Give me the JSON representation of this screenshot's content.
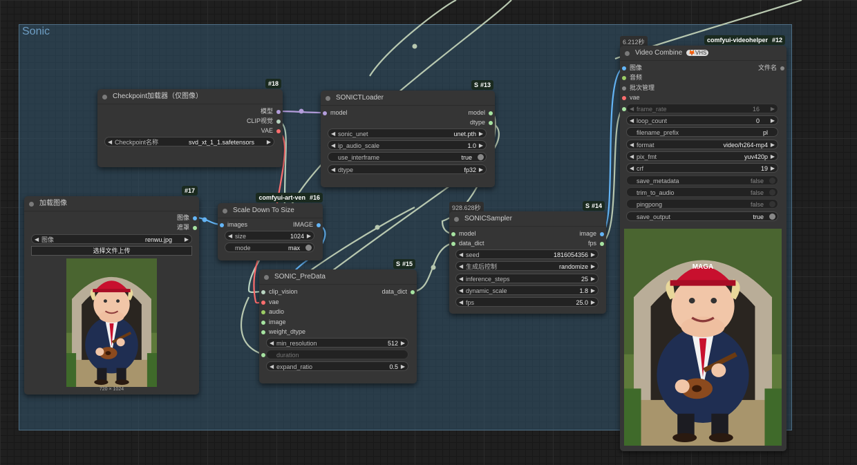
{
  "group": {
    "title": "Sonic"
  },
  "colors": {
    "model": "#b39ddb",
    "clip": "#f4d35e",
    "vae": "#ff6e6e",
    "image": "#64b5f6",
    "audio": "#9ccc65",
    "any": "#a6e3a1"
  },
  "n18": {
    "badge": "#18",
    "title": "Checkpoint加载器（仅图像）",
    "out_model": "模型",
    "out_clip": "CLIP视觉",
    "out_vae": "VAE",
    "ckpt_label": "Checkpoint名称",
    "ckpt_value": "svd_xt_1_1.safetensors"
  },
  "n13": {
    "badge": "#13",
    "badge_prefix": "S",
    "title": "SONICTLoader",
    "in_model": "model",
    "out_model": "model",
    "out_dtype": "dtype",
    "sonic_unet_label": "sonic_unet",
    "sonic_unet_value": "unet.pth",
    "ip_audio_scale_label": "ip_audio_scale",
    "ip_audio_scale_value": "1.0",
    "use_interframe_label": "use_interframe",
    "use_interframe_value": "true",
    "dtype_label": "dtype",
    "dtype_value": "fp32"
  },
  "n17": {
    "badge": "#17",
    "title": "加载图像",
    "out_image": "图像",
    "out_mask": "遮罩",
    "image_label": "图像",
    "image_value": "renwu.jpg",
    "upload_label": "选择文件上传",
    "caption": "720 × 1024"
  },
  "n16": {
    "badge": "#16",
    "badge_text": "comfyui-art-ven",
    "title": "Scale Down To Size",
    "in_images": "images",
    "out_image": "IMAGE",
    "size_label": "size",
    "size_value": "1024",
    "mode_label": "mode",
    "mode_value": "max"
  },
  "n15": {
    "badge": "#15",
    "badge_prefix": "S",
    "title": "SONIC_PreData",
    "in_clip_vision": "clip_vision",
    "in_vae": "vae",
    "in_audio": "audio",
    "in_image": "image",
    "in_weight_dtype": "weight_dtype",
    "out_data_dict": "data_dict",
    "min_resolution_label": "min_resolution",
    "min_resolution_value": "512",
    "duration_label": "duration",
    "expand_ratio_label": "expand_ratio",
    "expand_ratio_value": "0.5"
  },
  "n14": {
    "badge": "#14",
    "badge_prefix": "S",
    "timer": "928.628秒",
    "title": "SONICSampler",
    "in_model": "model",
    "in_data_dict": "data_dict",
    "out_image": "image",
    "out_fps": "fps",
    "seed_label": "seed",
    "seed_value": "1816054356",
    "control_label": "生成后控制",
    "control_value": "randomize",
    "steps_label": "inference_steps",
    "steps_value": "25",
    "dynamic_scale_label": "dynamic_scale",
    "dynamic_scale_value": "1.8",
    "fps_label": "fps",
    "fps_value": "25.0"
  },
  "n12": {
    "badge": "#12",
    "badge_text": "comfyui-videohelper",
    "timer": "6.212秒",
    "title": "Video Combine",
    "title_icons": "🦊VHS",
    "in_images": "图像",
    "in_audio": "音频",
    "in_batch": "批次管理",
    "in_vae": "vae",
    "out_filenames": "文件名",
    "frame_rate_label": "frame_rate",
    "frame_rate_value": "16",
    "loop_count_label": "loop_count",
    "loop_count_value": "0",
    "filename_prefix_label": "filename_prefix",
    "filename_prefix_value": "pl",
    "format_label": "format",
    "format_value": "video/h264-mp4",
    "pix_fmt_label": "pix_fmt",
    "pix_fmt_value": "yuv420p",
    "crf_label": "crf",
    "crf_value": "19",
    "save_metadata_label": "save_metadata",
    "save_metadata_value": "false",
    "trim_to_audio_label": "trim_to_audio",
    "trim_to_audio_value": "false",
    "pingpong_label": "pingpong",
    "pingpong_value": "false",
    "save_output_label": "save_output",
    "save_output_value": "true"
  },
  "preview": {
    "hat_text": "MAGA"
  }
}
